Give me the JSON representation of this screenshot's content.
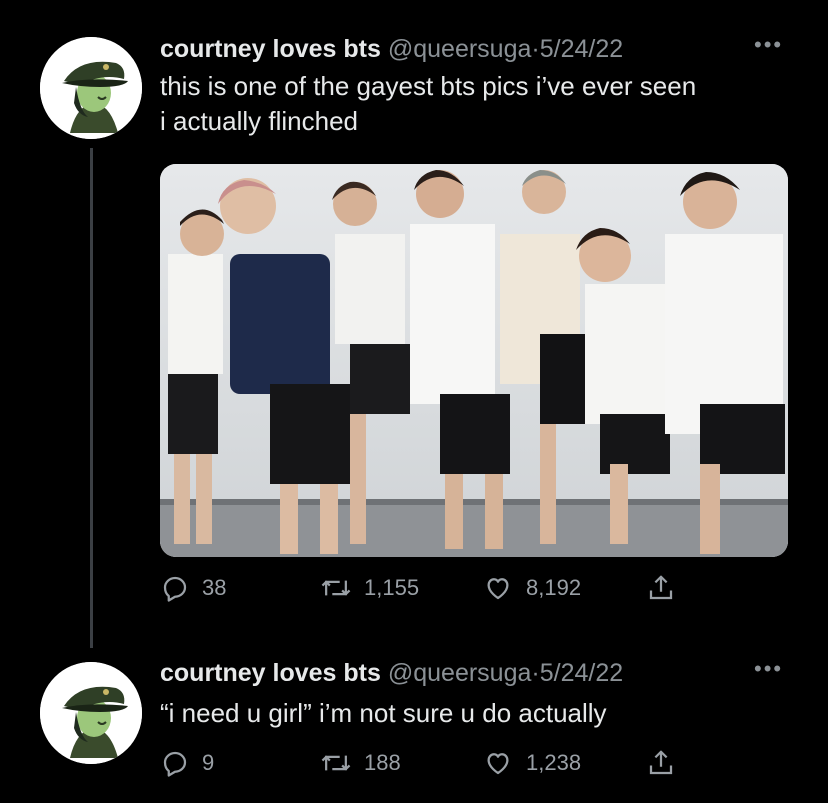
{
  "tweets": [
    {
      "author_name": "courtney loves bts",
      "handle": "@queersuga",
      "separator": "·",
      "date": "5/24/22",
      "more_label": "•••",
      "text_lines": [
        "this is one of the gayest bts pics i’ve ever seen",
        "i actually flinched"
      ],
      "replies": "38",
      "retweets": "1,155",
      "likes": "8,192"
    },
    {
      "author_name": "courtney loves bts",
      "handle": "@queersuga",
      "separator": "·",
      "date": "5/24/22",
      "more_label": "•••",
      "text_lines": [
        "“i need u girl” i’m not sure u do actually"
      ],
      "replies": "9",
      "retweets": "188",
      "likes": "1,238"
    }
  ],
  "icons": {
    "reply": "reply-icon",
    "retweet": "retweet-icon",
    "like": "heart-icon",
    "share": "share-icon",
    "more": "more-icon"
  },
  "colors": {
    "background": "#000000",
    "text": "#e7e9ea",
    "muted": "#8b9196",
    "thread_line": "#3b3f44"
  }
}
